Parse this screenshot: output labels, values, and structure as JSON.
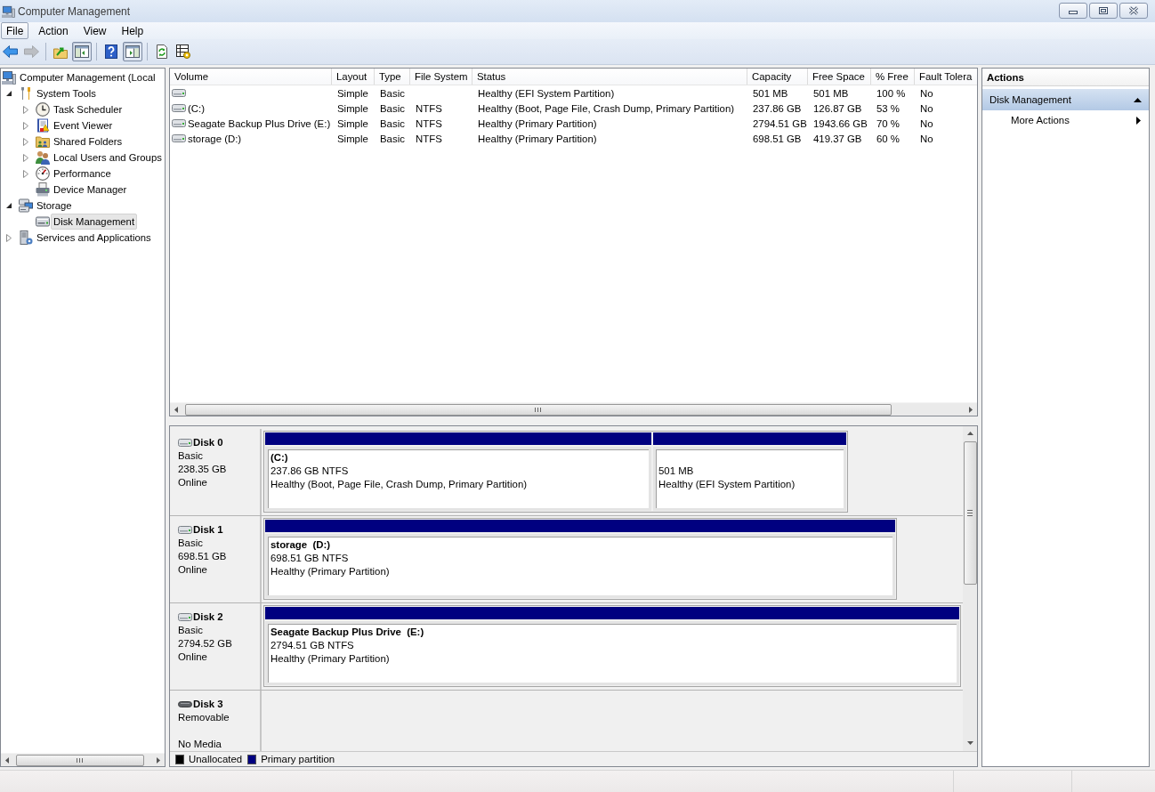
{
  "window": {
    "title": "Computer Management"
  },
  "menu": [
    {
      "label": "File",
      "selected": true
    },
    {
      "label": "Action",
      "selected": false
    },
    {
      "label": "View",
      "selected": false
    },
    {
      "label": "Help",
      "selected": false
    }
  ],
  "toolbar": [
    [
      {
        "kind": "back",
        "disabled": false,
        "pressed": false
      },
      {
        "kind": "forward",
        "disabled": true,
        "pressed": false
      }
    ],
    [
      {
        "kind": "up",
        "disabled": false,
        "pressed": false
      },
      {
        "kind": "tree",
        "disabled": false,
        "pressed": true
      }
    ],
    [
      {
        "kind": "help",
        "disabled": false,
        "pressed": false
      },
      {
        "kind": "actions",
        "disabled": false,
        "pressed": true
      }
    ],
    [
      {
        "kind": "refresh",
        "disabled": false,
        "pressed": false
      },
      {
        "kind": "properties",
        "disabled": false,
        "pressed": false
      }
    ]
  ],
  "tree": [
    {
      "label": "Computer Management (Local",
      "kind": "computer",
      "selected": false,
      "children": [
        {
          "label": "System Tools",
          "kind": "tools",
          "expanded": true,
          "selected": false,
          "children": [
            {
              "label": "Task Scheduler",
              "kind": "clock",
              "expanded": false,
              "selected": false
            },
            {
              "label": "Event Viewer",
              "kind": "log",
              "expanded": false,
              "selected": false
            },
            {
              "label": "Shared Folders",
              "kind": "share",
              "expanded": false,
              "selected": false
            },
            {
              "label": "Local Users and Groups",
              "kind": "users",
              "expanded": false,
              "selected": false
            },
            {
              "label": "Performance",
              "kind": "performance",
              "expanded": false,
              "selected": false
            },
            {
              "label": "Device Manager",
              "kind": "devices",
              "selected": false
            }
          ]
        },
        {
          "label": "Storage",
          "kind": "storage",
          "expanded": true,
          "selected": false,
          "children": [
            {
              "label": "Disk Management",
              "kind": "disk",
              "selected": true
            }
          ]
        },
        {
          "label": "Services and Applications",
          "kind": "services",
          "expanded": false,
          "selected": false
        }
      ]
    }
  ],
  "volumes": {
    "columns": [
      "Volume",
      "Layout",
      "Type",
      "File System",
      "Status",
      "Capacity",
      "Free Space",
      "% Free",
      "Fault Tolera"
    ],
    "rows": [
      {
        "layout": "Simple",
        "type": "Basic",
        "status": "Healthy (EFI System Partition)",
        "capacity": "501 MB",
        "free_space": "501 MB",
        "percent_free": "100 %",
        "fault_tolerance": "No"
      },
      {
        "volume": "(C:)",
        "layout": "Simple",
        "type": "Basic",
        "file_system": "NTFS",
        "status": "Healthy (Boot, Page File, Crash Dump, Primary Partition)",
        "capacity": "237.86 GB",
        "free_space": "126.87 GB",
        "percent_free": "53 %",
        "fault_tolerance": "No"
      },
      {
        "volume": "Seagate Backup Plus Drive (E:)",
        "layout": "Simple",
        "type": "Basic",
        "file_system": "NTFS",
        "status": "Healthy (Primary Partition)",
        "capacity": "2794.51 GB",
        "free_space": "1943.66 GB",
        "percent_free": "70 %",
        "fault_tolerance": "No"
      },
      {
        "volume": "storage (D:)",
        "layout": "Simple",
        "type": "Basic",
        "file_system": "NTFS",
        "status": "Healthy (Primary Partition)",
        "capacity": "698.51 GB",
        "free_space": "419.37 GB",
        "percent_free": "60 %",
        "fault_tolerance": "No"
      }
    ]
  },
  "disks": [
    {
      "name": "Disk 0",
      "kind": "fixed",
      "type": "Basic",
      "size": "238.35 GB",
      "status": "Online",
      "partitions": [
        {
          "kind": "primary",
          "label": "(C:)",
          "size": "237.86 GB NTFS",
          "status": "Healthy (Boot, Page File, Crash Dump, Primary Partition)"
        },
        {
          "kind": "primary",
          "size": "501 MB",
          "status": "Healthy (EFI System Partition)"
        }
      ]
    },
    {
      "name": "Disk 1",
      "kind": "fixed",
      "type": "Basic",
      "size": "698.51 GB",
      "status": "Online",
      "partitions": [
        {
          "kind": "primary",
          "label": "storage  (D:)",
          "size": "698.51 GB NTFS",
          "status": "Healthy (Primary Partition)"
        }
      ]
    },
    {
      "name": "Disk 2",
      "kind": "fixed",
      "type": "Basic",
      "size": "2794.52 GB",
      "status": "Online",
      "partitions": [
        {
          "kind": "primary",
          "label": "Seagate Backup Plus Drive  (E:)",
          "size": "2794.51 GB NTFS",
          "status": "Healthy (Primary Partition)"
        }
      ]
    },
    {
      "name": "Disk 3",
      "kind": "removable",
      "type": "Removable",
      "status": "No Media"
    }
  ],
  "legend": [
    {
      "label": "Unallocated",
      "color": "#000000"
    },
    {
      "label": "Primary partition",
      "color": "#000080"
    }
  ],
  "actions": {
    "title": "Actions",
    "sections": [
      {
        "label": "Disk Management",
        "expanded": true,
        "items": [
          {
            "label": "More Actions",
            "submenu": true
          }
        ]
      }
    ]
  }
}
